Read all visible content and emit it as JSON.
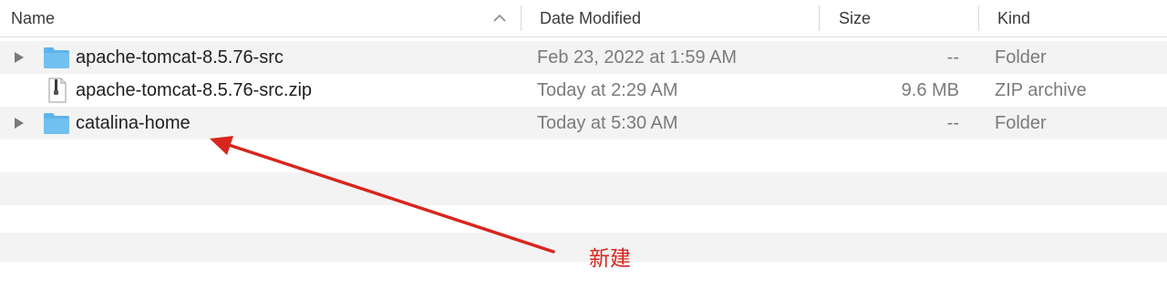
{
  "columns": {
    "name": "Name",
    "date_modified": "Date Modified",
    "size": "Size",
    "kind": "Kind"
  },
  "rows": [
    {
      "name": "apache-tomcat-8.5.76-src",
      "date": "Feb 23, 2022 at 1:59 AM",
      "size": "--",
      "kind": "Folder",
      "icon": "folder-icon",
      "expandable": true
    },
    {
      "name": "apache-tomcat-8.5.76-src.zip",
      "date": "Today at 2:29 AM",
      "size": "9.6 MB",
      "kind": "ZIP archive",
      "icon": "zip-file-icon",
      "expandable": false
    },
    {
      "name": "catalina-home",
      "date": "Today at 5:30 AM",
      "size": "--",
      "kind": "Folder",
      "icon": "folder-icon",
      "expandable": true
    }
  ],
  "annotation": {
    "text": "新建",
    "color": "#d7261e"
  },
  "colors": {
    "folder": "#5fb3ea",
    "row_alt": "#f3f3f3"
  }
}
